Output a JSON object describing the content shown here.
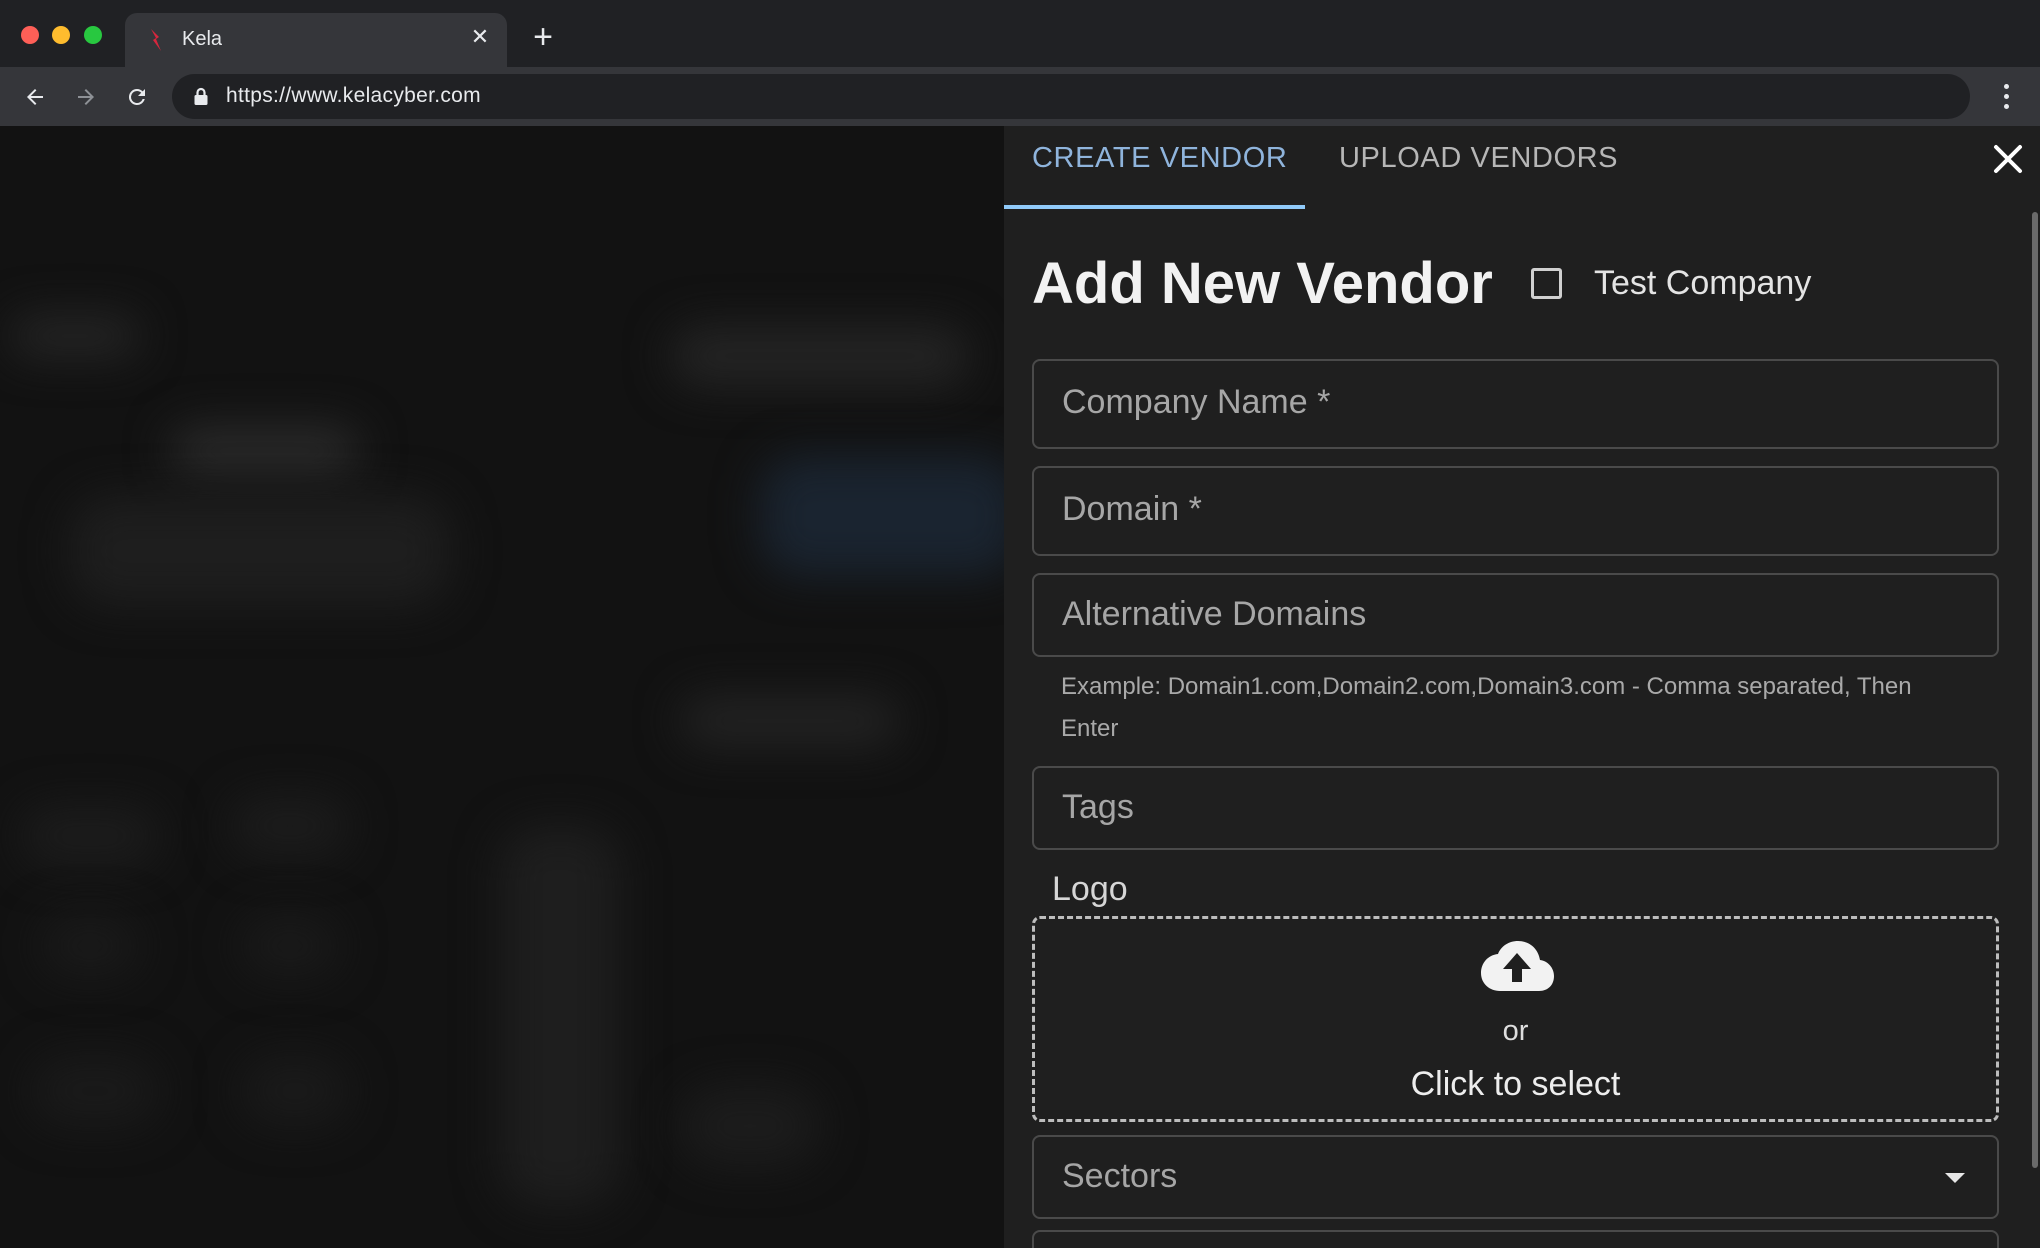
{
  "browser": {
    "tab_title": "Kela",
    "url": "https://www.kelacyber.com"
  },
  "drawer": {
    "tabs": [
      {
        "label": "CREATE VENDOR",
        "active": true
      },
      {
        "label": "UPLOAD VENDORS",
        "active": false
      }
    ],
    "title": "Add New Vendor",
    "test_company": {
      "label": "Test Company",
      "checked": false
    },
    "fields": {
      "company_name": "Company Name *",
      "domain": "Domain *",
      "alternative_domains": "Alternative Domains",
      "alternative_domains_helper": "Example: Domain1.com,Domain2.com,Domain3.com - Comma separated, Then Enter",
      "tags": "Tags",
      "sectors": "Sectors"
    },
    "logo": {
      "label": "Logo",
      "or_text": "or",
      "click_text": "Click to select"
    }
  },
  "colors": {
    "accent": "#90caf9",
    "drawer_bg": "#1f1f1f",
    "chrome_bg": "#202124"
  },
  "icons": [
    "back-arrow-icon",
    "forward-arrow-icon",
    "reload-icon",
    "lock-icon",
    "more-vert-icon",
    "close-icon",
    "cloud-upload-icon",
    "dropdown-caret-icon"
  ]
}
